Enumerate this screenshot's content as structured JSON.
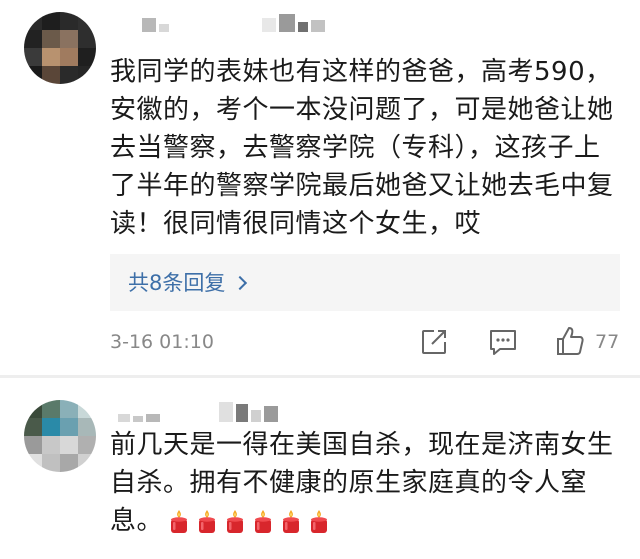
{
  "comments": [
    {
      "text_lines": [
        "我同学的表妹也有这样的爸爸，高考590，",
        "安徽的，考个一本没问题了，可是她爸让她",
        "去当警察，去警察学院（专科），这孩子上",
        "了半年的警察学院最后她爸又让她去毛中复",
        "读！很同情很同情这个女生，哎"
      ],
      "replies_label": "共8条回复",
      "time": "3-16 01:10",
      "like_count": "77"
    },
    {
      "text_lines": [
        "前几天是一得在美国自杀，现在是济南女生",
        "自杀。拥有不健康的原生家庭真的令人窒",
        "息。"
      ],
      "emoji_name": "candle-emoji",
      "emoji_count": 6
    }
  ],
  "colors": {
    "link": "#3d6fa8",
    "meta": "#888888",
    "reply_bg": "#f5f5f5"
  }
}
